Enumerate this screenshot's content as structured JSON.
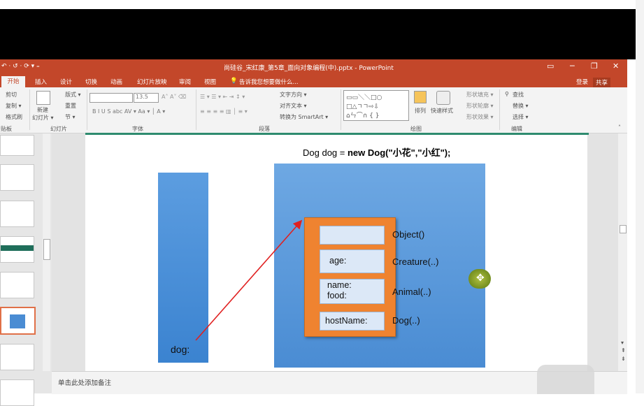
{
  "window": {
    "title": "尚硅谷_宋红康_第5章_面向对象编程(中).pptx - PowerPoint",
    "controls": [
      "▭",
      "─",
      "❐",
      "✕"
    ]
  },
  "quick_access": "↶ · ↺ · ⟳ ▾ ₌",
  "tabs": [
    "开始",
    "插入",
    "设计",
    "切换",
    "动画",
    "幻灯片放映",
    "审阅",
    "视图"
  ],
  "tell_me": "告诉我您想要做什么...",
  "account": {
    "login": "登录",
    "share": "共享"
  },
  "ribbon": {
    "clipboard": {
      "cut": "剪切",
      "copy": "复制 ▾",
      "format_painter": "格式刷",
      "group": "贴板"
    },
    "slides": {
      "new_slide": "新建",
      "new_slide2": "幻灯片 ▾",
      "layout": "版式 ▾",
      "reset": "重置",
      "section": "节 ▾",
      "group": "幻灯片"
    },
    "font": {
      "size": "13.5",
      "group": "字体"
    },
    "paragraph": {
      "text_direction": "文字方向 ▾",
      "align_text": "对齐文本 ▾",
      "smartart": "转换为 SmartArt ▾",
      "group": "段落"
    },
    "drawing": {
      "arrange": "排列",
      "quick_styles": "快速样式",
      "shape_fill": "形状填充 ▾",
      "shape_outline": "形状轮廓 ▾",
      "shape_effects": "形状效果 ▾",
      "group": "绘图"
    },
    "editing": {
      "find": "查找",
      "replace": "替换 ▾",
      "select": "选择 ▾",
      "group": "编辑"
    }
  },
  "slide": {
    "code_prefix": "Dog dog = ",
    "code_bold": "new Dog(\"小花\",\"小红\");",
    "stack_label": "dog:",
    "fields": [
      "",
      "age:",
      "name:\nfood:",
      "hostName:"
    ],
    "classes": [
      "Object()",
      "Creature(..)",
      "Animal(..)",
      "Dog(..)"
    ]
  },
  "notes": {
    "placeholder": "单击此处添加备注"
  },
  "colors": {
    "titlebar": "#c3472a",
    "heap": "#4a8cd3",
    "object": "#ef8330",
    "field": "#dce8f7",
    "arrow": "#e02020"
  }
}
